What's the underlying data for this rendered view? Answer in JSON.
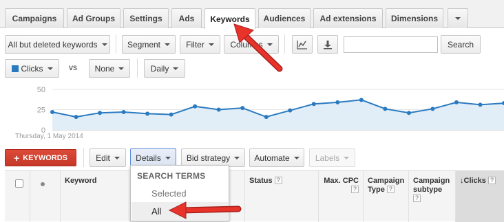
{
  "tabs": [
    {
      "label": "Campaigns",
      "active": false
    },
    {
      "label": "Ad Groups",
      "active": false
    },
    {
      "label": "Settings",
      "active": false
    },
    {
      "label": "Ads",
      "active": false
    },
    {
      "label": "Keywords",
      "active": true
    },
    {
      "label": "Audiences",
      "active": false
    },
    {
      "label": "Ad extensions",
      "active": false
    },
    {
      "label": "Dimensions",
      "active": false
    }
  ],
  "toolbar": {
    "filter_view_label": "All but deleted keywords",
    "segment_label": "Segment",
    "filter_label": "Filter",
    "columns_label": "Columns",
    "chart_icon": "line-chart-icon",
    "download_icon": "download-icon",
    "search_value": "",
    "search_button_label": "Search"
  },
  "chart_controls": {
    "metric1_label": "Clicks",
    "metric1_color": "#2a7ac0",
    "vs_label": "vs",
    "metric2_label": "None",
    "period_label": "Daily"
  },
  "chart_data": {
    "type": "area",
    "y_ticks": [
      "50",
      "25",
      "0"
    ],
    "ylim": [
      0,
      50
    ],
    "date_label": "Thursday, 1 May 2014",
    "series": [
      {
        "values": [
          22,
          16,
          21,
          22,
          20,
          19,
          29,
          25,
          27,
          16,
          24,
          32,
          34,
          37,
          26,
          21,
          26,
          34,
          31,
          33
        ]
      }
    ],
    "color": "#2a7ac0",
    "fill": "#e1edf7",
    "grid": true
  },
  "actions": {
    "add_label": "KEYWORDS",
    "edit_label": "Edit",
    "details_label": "Details",
    "bid_strategy_label": "Bid strategy",
    "automate_label": "Automate",
    "labels_label": "Labels"
  },
  "table": {
    "columns": {
      "keyword": "Keyword",
      "status": "Status",
      "max_cpc": "Max. CPC",
      "campaign_type": "Campaign Type",
      "campaign_subtype": "Campaign subtype",
      "clicks": "Clicks"
    },
    "help_glyph": "?",
    "sort_icon": "sort-down-arrow-icon"
  },
  "details_menu": {
    "heading": "SEARCH TERMS",
    "items": [
      {
        "label": "Selected",
        "selected": false
      },
      {
        "label": "All",
        "selected": true
      }
    ]
  },
  "annotations": {
    "arrow_color": "#e8332a"
  }
}
